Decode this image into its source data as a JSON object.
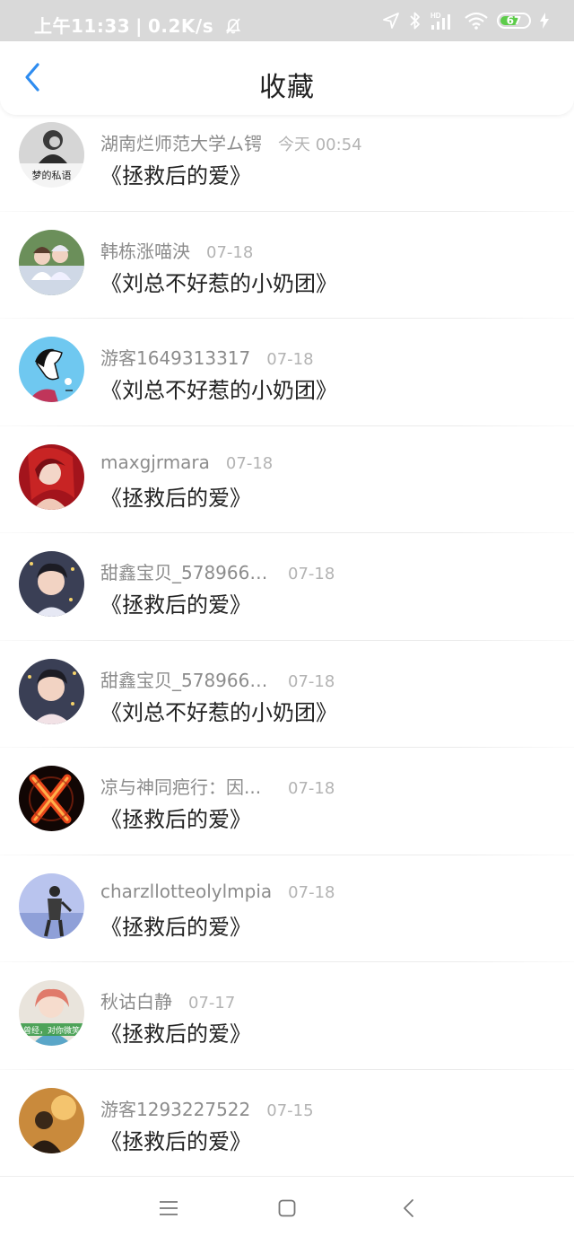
{
  "status_bar": {
    "time": "上午11:33",
    "separator": "|",
    "net_speed": "0.2K/s",
    "battery_level": "67",
    "battery_fraction": 0.67,
    "battery_color": "#5dcc4a",
    "icons": [
      "bell-off-icon",
      "location-icon",
      "bluetooth-icon",
      "hd-signal-icon",
      "wifi-icon",
      "battery-icon",
      "charging-icon"
    ]
  },
  "header": {
    "title": "收藏",
    "back_icon": "chevron-left-icon",
    "accent": "#2e8cf0"
  },
  "favorites": [
    {
      "user": "湖南烂师范大学ム锷",
      "date": "今天 00:54",
      "title": "《拯救后的爱》",
      "avatar": "avatar-photo-1"
    },
    {
      "user": "韩栋涨喵泱",
      "date": "07-18",
      "title": "《刘总不好惹的小奶团》",
      "avatar": "avatar-photo-2"
    },
    {
      "user": "游客1649313317",
      "date": "07-18",
      "title": "《刘总不好惹的小奶团》",
      "avatar": "avatar-photo-3"
    },
    {
      "user": "maxgjrmara",
      "date": "07-18",
      "title": "《拯救后的爱》",
      "avatar": "avatar-photo-4"
    },
    {
      "user": "甜鑫宝贝_5789663...",
      "date": "07-18",
      "title": "《拯救后的爱》",
      "avatar": "avatar-photo-5"
    },
    {
      "user": "甜鑫宝贝_5789663...",
      "date": "07-18",
      "title": "《刘总不好惹的小奶团》",
      "avatar": "avatar-photo-6"
    },
    {
      "user": "凉与神同疤行：因...",
      "date": "07-18",
      "title": "《拯救后的爱》",
      "avatar": "avatar-photo-7"
    },
    {
      "user": "charzllotteolylmpia",
      "date": "07-18",
      "title": "《拯救后的爱》",
      "avatar": "avatar-photo-8"
    },
    {
      "user": "秋诂白静",
      "date": "07-17",
      "title": "《拯救后的爱》",
      "avatar": "avatar-photo-9"
    },
    {
      "user": "游客1293227522",
      "date": "07-15",
      "title": "《拯救后的爱》",
      "avatar": "avatar-photo-10"
    }
  ],
  "avatar_text": {
    "first": "梦的私语",
    "ninth": "曾经，对你微笑"
  },
  "nav_bar": {
    "icons": [
      "menu-icon",
      "home-square-icon",
      "back-triangle-icon"
    ]
  }
}
